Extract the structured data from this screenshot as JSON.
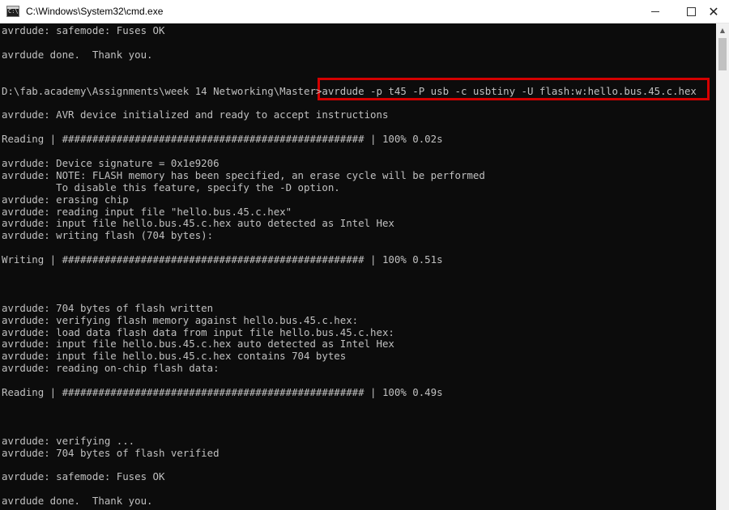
{
  "window": {
    "title": "C:\\Windows\\System32\\cmd.exe",
    "icon_text": "C:\\",
    "controls": {
      "minimize": "minimize-icon",
      "maximize": "maximize-icon",
      "close": "close-icon",
      "close_glyph": "✕"
    }
  },
  "console": {
    "lines": [
      "avrdude: safemode: Fuses OK",
      "",
      "avrdude done.  Thank you.",
      "",
      "",
      "D:\\fab.academy\\Assignments\\week 14 Networking\\Master>avrdude -p t45 -P usb -c usbtiny -U flash:w:hello.bus.45.c.hex",
      "",
      "avrdude: AVR device initialized and ready to accept instructions",
      "",
      "Reading | ################################################## | 100% 0.02s",
      "",
      "avrdude: Device signature = 0x1e9206",
      "avrdude: NOTE: FLASH memory has been specified, an erase cycle will be performed",
      "         To disable this feature, specify the -D option.",
      "avrdude: erasing chip",
      "avrdude: reading input file \"hello.bus.45.c.hex\"",
      "avrdude: input file hello.bus.45.c.hex auto detected as Intel Hex",
      "avrdude: writing flash (704 bytes):",
      "",
      "Writing | ################################################## | 100% 0.51s",
      "",
      "",
      "",
      "avrdude: 704 bytes of flash written",
      "avrdude: verifying flash memory against hello.bus.45.c.hex:",
      "avrdude: load data flash data from input file hello.bus.45.c.hex:",
      "avrdude: input file hello.bus.45.c.hex auto detected as Intel Hex",
      "avrdude: input file hello.bus.45.c.hex contains 704 bytes",
      "avrdude: reading on-chip flash data:",
      "",
      "Reading | ################################################## | 100% 0.49s",
      "",
      "",
      "",
      "avrdude: verifying ...",
      "avrdude: 704 bytes of flash verified",
      "",
      "avrdude: safemode: Fuses OK",
      "",
      "avrdude done.  Thank you."
    ],
    "colors": {
      "background": "#0c0c0c",
      "text": "#c0c0c0",
      "highlight": "#d40000"
    }
  }
}
